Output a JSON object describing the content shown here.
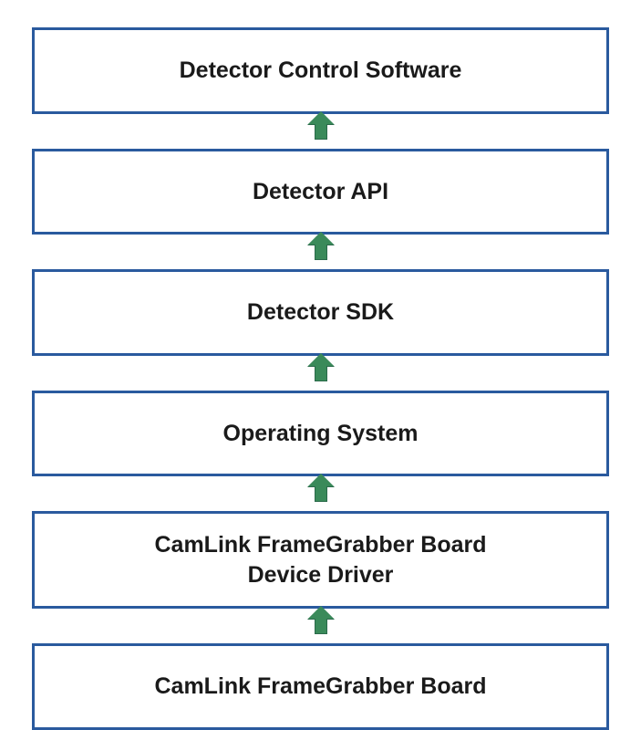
{
  "layers": {
    "layer0": "Detector Control Software",
    "layer1": "Detector API",
    "layer2": "Detector SDK",
    "layer3": "Operating System",
    "layer4_line1": "CamLink FrameGrabber Board",
    "layer4_line2": "Device Driver",
    "layer5": "CamLink FrameGrabber Board"
  },
  "colors": {
    "box_border": "#2a5a9e",
    "arrow_fill": "#3a8a5a"
  }
}
